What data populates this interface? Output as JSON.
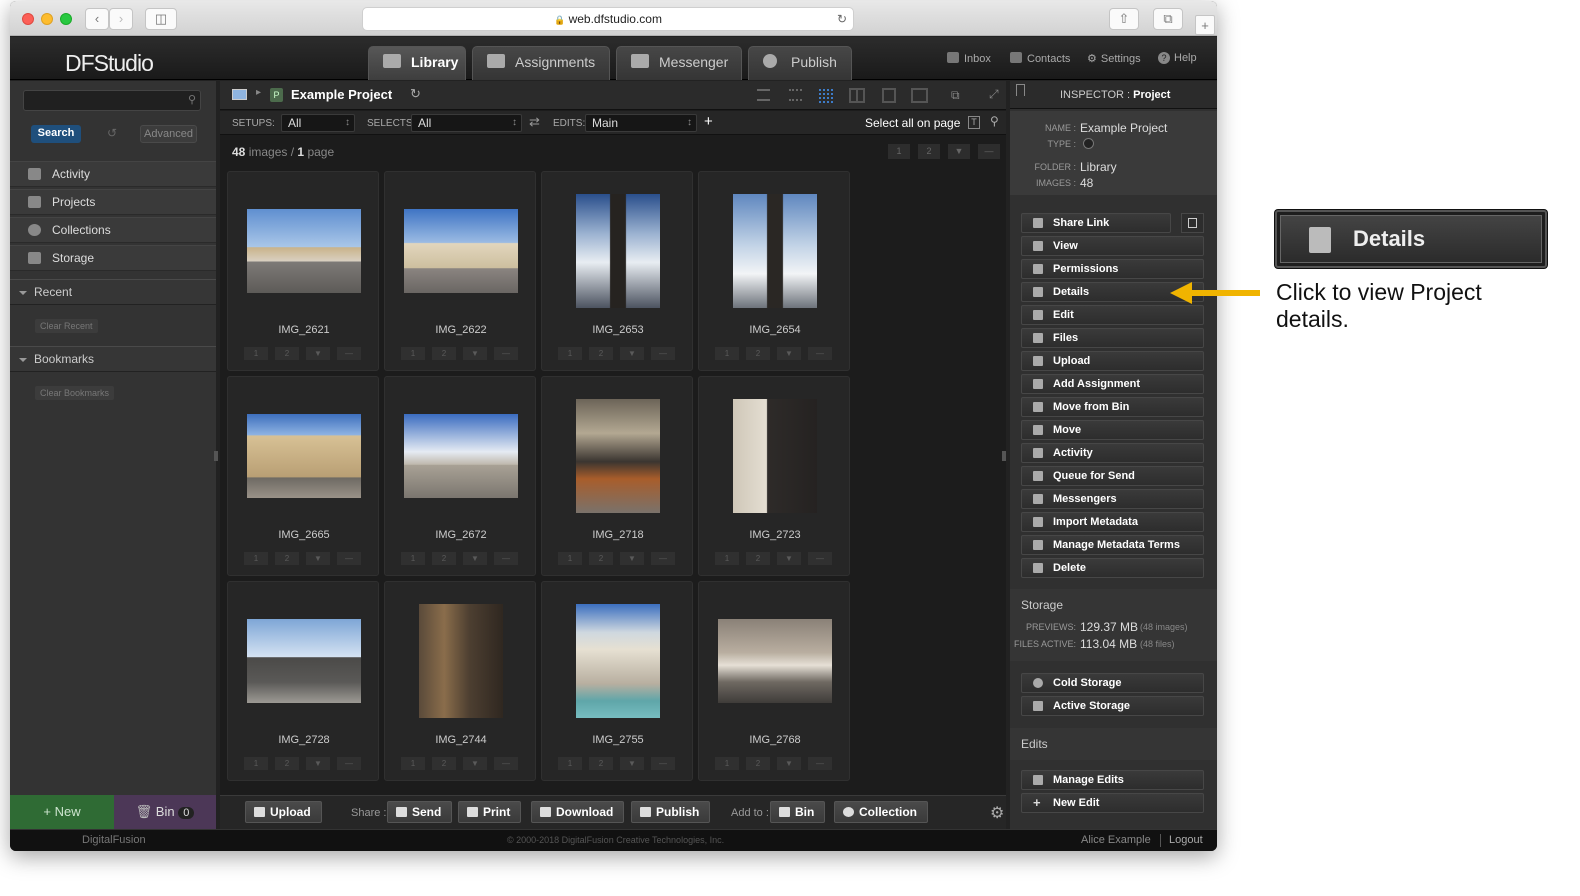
{
  "browser": {
    "url": "web.dfstudio.com"
  },
  "app": {
    "logo": "DFStudio",
    "tabs": [
      "Library",
      "Assignments",
      "Messenger",
      "Publish"
    ],
    "top_links": [
      "Inbox",
      "Contacts",
      "Settings",
      "Help"
    ]
  },
  "sidebar": {
    "search_button": "Search",
    "advanced_button": "Advanced",
    "nav": [
      "Activity",
      "Projects",
      "Collections",
      "Storage"
    ],
    "recent": "Recent",
    "clear_recent": "Clear Recent",
    "bookmarks": "Bookmarks",
    "clear_bookmarks": "Clear Bookmarks",
    "new_button": "+ New",
    "bin_button": "Bin",
    "bin_count": "0"
  },
  "main": {
    "project_badge": "P",
    "project_title": "Example Project",
    "setups_label": "SETUPS:",
    "setups_value": "All",
    "selects_label": "SELECTS:",
    "selects_value": "All",
    "edits_label": "EDITS:",
    "edits_value": "Main",
    "select_all": "Select all on page",
    "image_count": "48",
    "images_word": "images",
    "slash": "/",
    "page_count": "1",
    "page_word": "page",
    "rating_labels": [
      "1",
      "2"
    ],
    "images": [
      "IMG_2621",
      "IMG_2622",
      "IMG_2653",
      "IMG_2654",
      "IMG_2665",
      "IMG_2672",
      "IMG_2718",
      "IMG_2723",
      "IMG_2728",
      "IMG_2744",
      "IMG_2755",
      "IMG_2768"
    ]
  },
  "bottom": {
    "upload": "Upload",
    "share_label": "Share :",
    "send": "Send",
    "print": "Print",
    "download": "Download",
    "publish": "Publish",
    "add_to_label": "Add to :",
    "bin": "Bin",
    "collection": "Collection"
  },
  "inspector": {
    "title_prefix": "INSPECTOR :",
    "title": "Project",
    "name_key": "NAME :",
    "name_value": "Example Project",
    "type_key": "TYPE :",
    "folder_key": "FOLDER :",
    "folder_value": "Library",
    "images_key": "IMAGES :",
    "images_value": "48",
    "actions": [
      "Share Link",
      "View",
      "Permissions",
      "Details",
      "Edit",
      "Files",
      "Upload",
      "Add Assignment",
      "Move from Bin",
      "Move",
      "Activity",
      "Queue for Send",
      "Messengers",
      "Import Metadata",
      "Manage Metadata Terms",
      "Delete"
    ],
    "storage_title": "Storage",
    "previews_key": "PREVIEWS:",
    "previews_value": "129.37 MB",
    "previews_note": "(48 images)",
    "files_key": "FILES ACTIVE:",
    "files_value": "113.04 MB",
    "files_note": "(48 files)",
    "storage_actions": [
      "Cold Storage",
      "Active Storage"
    ],
    "edits_title": "Edits",
    "edit_actions": [
      "Manage Edits",
      "New Edit"
    ]
  },
  "footer": {
    "brand": "DigitalFusion",
    "copyright": "© 2000-2018 DigitalFusion Creative Technologies, Inc.",
    "user": "Alice Example",
    "logout": "Logout"
  },
  "callout": {
    "button": "Details",
    "text": "Click to view Project details.",
    "arrow_color": "#f0b400"
  },
  "colors": {
    "new_green": "#2f6b34",
    "bin_purple": "#4c3757",
    "search_blue": "#1f4f7c",
    "view_highlight": "#3d7cc9"
  }
}
